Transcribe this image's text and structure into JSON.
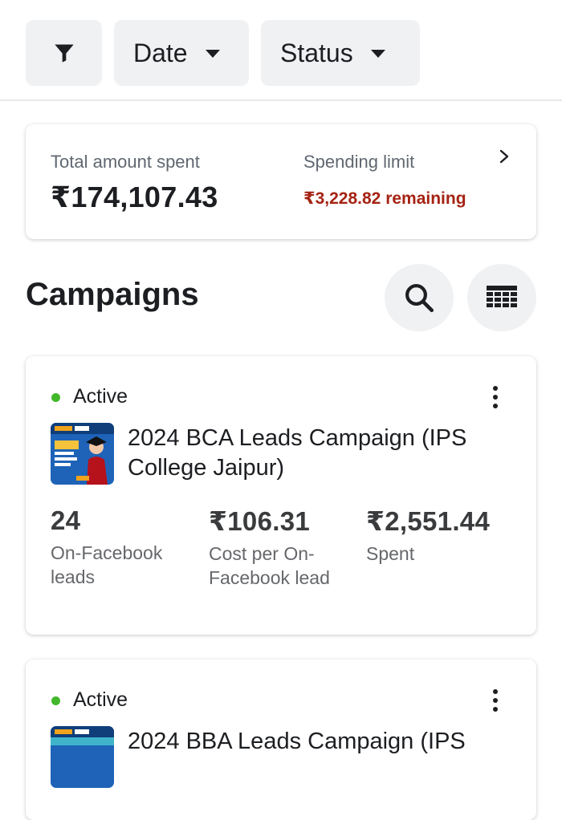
{
  "filters": {
    "filter_icon": "filter-funnel-icon",
    "date_label": "Date",
    "status_label": "Status"
  },
  "spend": {
    "total_label": "Total amount spent",
    "total_value": "₹174,107.43",
    "limit_label": "Spending limit",
    "remaining": "₹3,228.82 remaining",
    "remaining_color": "#a52313"
  },
  "campaigns_section": {
    "title": "Campaigns",
    "search_icon": "search-icon",
    "table_icon": "table-grid-icon"
  },
  "campaigns": [
    {
      "status": "Active",
      "status_color": "#42b72a",
      "name": "2024 BCA Leads Campaign (IPS College Jaipur)",
      "metrics": [
        {
          "value": "24",
          "label": "On-Facebook leads"
        },
        {
          "value": "₹106.31",
          "label": "Cost per On-Facebook lead"
        },
        {
          "value": "₹2,551.44",
          "label": "Spent"
        }
      ]
    },
    {
      "status": "Active",
      "status_color": "#42b72a",
      "name": "2024 BBA Leads Campaign (IPS"
    }
  ]
}
